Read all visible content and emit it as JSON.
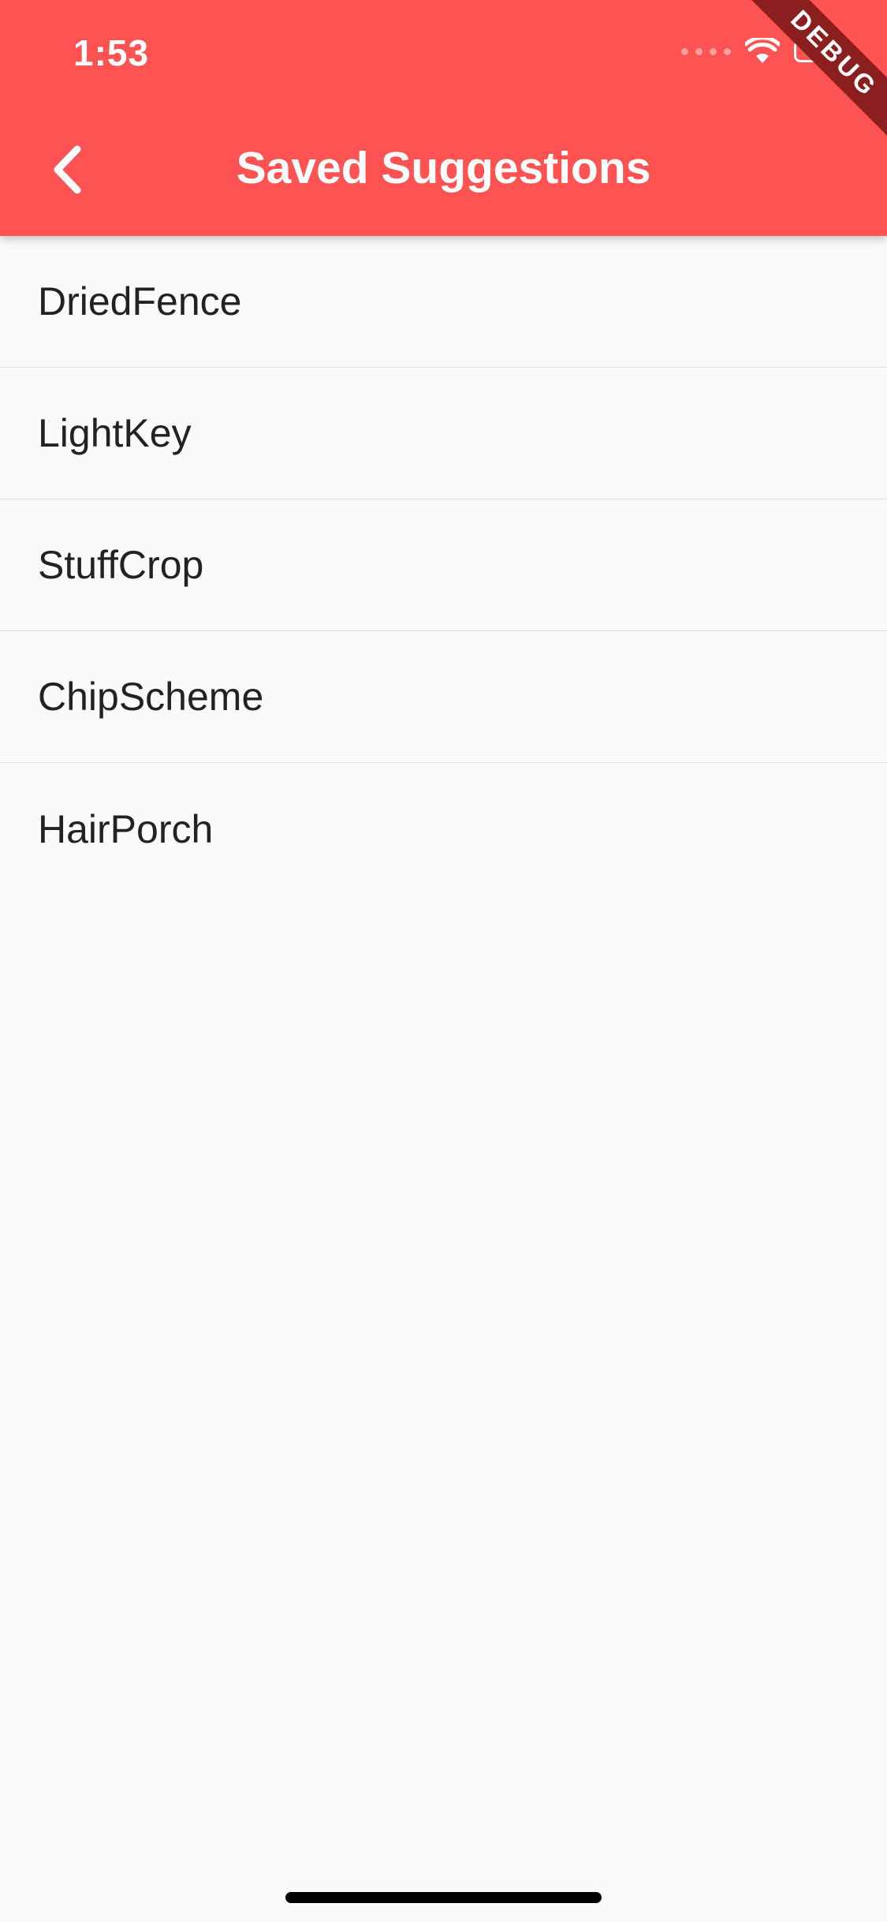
{
  "status_bar": {
    "time": "1:53",
    "debug_banner": "DEBUG"
  },
  "app_bar": {
    "title": "Saved Suggestions",
    "back_icon": "chevron-left-icon",
    "background_color": "#ff5252"
  },
  "suggestions": [
    {
      "label": "DriedFence"
    },
    {
      "label": "LightKey"
    },
    {
      "label": "StuffCrop"
    },
    {
      "label": "ChipScheme"
    },
    {
      "label": "HairPorch"
    }
  ]
}
